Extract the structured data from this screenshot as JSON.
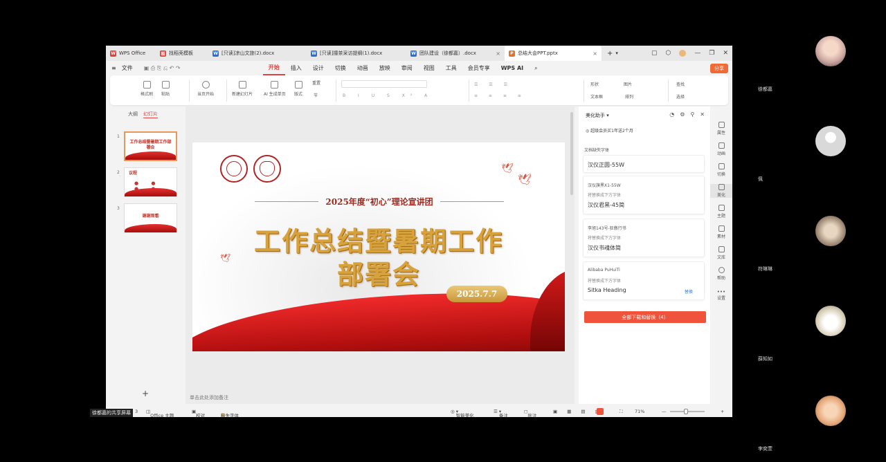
{
  "tabs": [
    {
      "label": "WPS Office",
      "icon": "wps-logo-icon",
      "color": "#e0413a"
    },
    {
      "label": "找稻壳模板",
      "icon": "template-icon",
      "color": "#e0413a"
    },
    {
      "label": "[只读]凉山文旅(2).docx",
      "icon": "word-doc-icon",
      "color": "#2b6fd6"
    },
    {
      "label": "[只读]撞茶采访提纲(1).docx",
      "icon": "word-doc-icon",
      "color": "#2b6fd6"
    },
    {
      "label": "团队建设（徐都嘉）.docx",
      "icon": "word-doc-icon",
      "color": "#2b6fd6"
    },
    {
      "label": "总结大会PPT.pptx",
      "icon": "ppt-doc-icon",
      "color": "#e8702a"
    }
  ],
  "menu": {
    "file": "文件",
    "items": [
      "开始",
      "插入",
      "设计",
      "切换",
      "动画",
      "放映",
      "审阅",
      "视图",
      "工具",
      "会员专享",
      "WPS AI"
    ],
    "active": "开始",
    "share": "分享"
  },
  "ribbon": {
    "format_painter": "格式刷",
    "paste": "粘贴",
    "from_current": "当页开始",
    "new_slide": "新建幻灯片",
    "ai_slide": "AI 生成单页",
    "layout": "版式",
    "section": "节",
    "reset": "重置",
    "shape": "形状",
    "picture": "图片",
    "textbox": "文本框",
    "arrange": "排列",
    "find": "查找",
    "select": "选择"
  },
  "thumbs": {
    "tab_outline": "大纲",
    "tab_slides": "幻灯片",
    "items": [
      {
        "num": "1",
        "text": "工作总结暨暑期工作部署会",
        "selected": true
      },
      {
        "num": "2",
        "text": "议程",
        "selected": false
      },
      {
        "num": "3",
        "text": "谢谢观看",
        "selected": false
      }
    ],
    "add": "+"
  },
  "slide": {
    "subtitle": "2025年度“初心”理论宣讲团",
    "title_line1": "工作总结暨暑期工作",
    "title_line2": "部署会",
    "date": "2025.7.7"
  },
  "note_placeholder": "单击此处添加备注",
  "panel": {
    "title": "美化助手",
    "membership": "超级会员买1年送2个月",
    "missing_fonts": "文档缺失字体",
    "fonts": [
      {
        "name": "汉仪正圆-55W",
        "hint": "",
        "replacement": ""
      },
      {
        "name": "汉仪旗黑X1-55W",
        "hint": "将替换成下方字体",
        "replacement": "汉仪君黑-45简"
      },
      {
        "name": "李旭143号-狂傲行书",
        "hint": "将替换成下方字体",
        "replacement": "汉仪书魂体简"
      },
      {
        "name": "Alibaba PuHuiTi",
        "hint": "将替换成下方字体",
        "replacement": "Sitka Heading",
        "link": "替换"
      }
    ],
    "download_all": "全部下载和替换（4）"
  },
  "rail": [
    "属性",
    "动画",
    "切换",
    "美化",
    "主题",
    "素材",
    "文库",
    "帮助",
    "设置"
  ],
  "status": {
    "slide_info": "3",
    "theme": "Office 主题",
    "proofread": "校对",
    "missing_font": "缺失字体",
    "smart_beautify": "智能美化",
    "notes": "备注",
    "comments": "批注",
    "zoom": "71%"
  },
  "share_label": "徐都嘉的共享屏幕",
  "participants": [
    {
      "name": "徐都嘉",
      "avatar": "anime-girl-avatar"
    },
    {
      "name": "佩",
      "avatar": "default-user-avatar"
    },
    {
      "name": "符琳琳",
      "avatar": "cat-avatar"
    },
    {
      "name": "薛知如",
      "avatar": "cartoon-girl-avatar"
    },
    {
      "name": "李奕萱",
      "avatar": "doll-avatar"
    }
  ]
}
